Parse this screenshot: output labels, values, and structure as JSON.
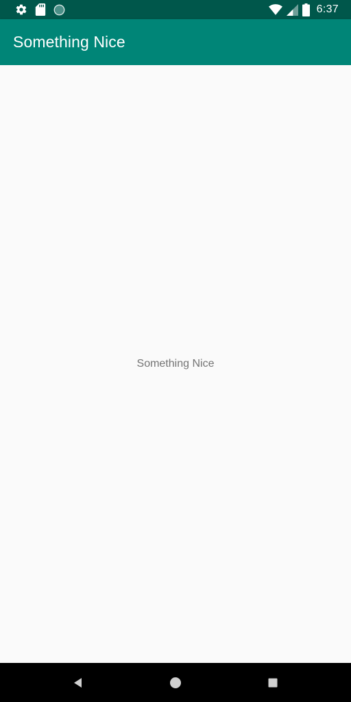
{
  "status_bar": {
    "time": "6:37",
    "left_icons": [
      "gear-icon",
      "sd-card-icon",
      "circle-icon"
    ],
    "right_icons": [
      "wifi-icon",
      "signal-icon",
      "battery-icon"
    ],
    "background": "#00574b"
  },
  "app_bar": {
    "title": "Something Nice",
    "background": "#008577"
  },
  "main": {
    "center_text": "Something Nice"
  },
  "nav_bar": {
    "buttons": [
      "back-icon",
      "home-icon",
      "recents-icon"
    ]
  }
}
